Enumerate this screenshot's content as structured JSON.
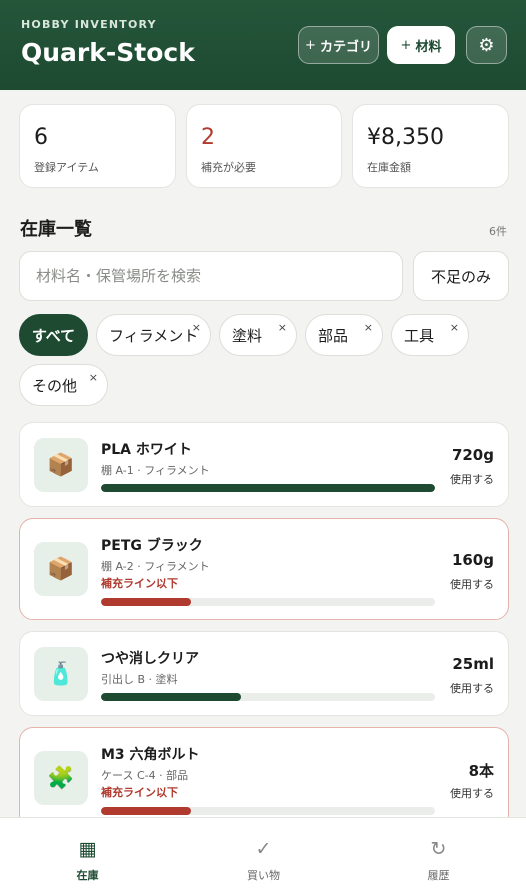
{
  "header": {
    "kicker": "HOBBY INVENTORY",
    "title": "Quark-Stock",
    "add_category_label": "カテゴリ",
    "add_material_label": "材料",
    "plus_glyph": "+",
    "settings_icon": "gear-icon"
  },
  "stats": [
    {
      "value": "6",
      "label": "登録アイテム"
    },
    {
      "value": "2",
      "label": "補充が必要"
    },
    {
      "value": "¥8,350",
      "label": "在庫金額"
    }
  ],
  "inventory": {
    "title": "在庫一覧",
    "count": "6件",
    "search_placeholder": "材料名・保管場所を検索",
    "search_value": "",
    "shortage_only_label": "不足のみ"
  },
  "chips": [
    {
      "label": "すべて",
      "active": true
    },
    {
      "label": "フィラメント",
      "active": false
    },
    {
      "label": "塗料",
      "active": false
    },
    {
      "label": "部品",
      "active": false
    },
    {
      "label": "工具",
      "active": false
    },
    {
      "label": "その他",
      "active": false
    }
  ],
  "chip_remove_glyph": "×",
  "items": [
    {
      "name": "PLA ホワイト",
      "meta": "棚 A-1 · フィラメント",
      "warning": "",
      "quantity": "720g",
      "action": "使用する",
      "level": 1.0,
      "icon": "box-icon",
      "low": false
    },
    {
      "name": "PETG ブラック",
      "meta": "棚 A-2 · フィラメント",
      "warning": "補充ライン以下",
      "quantity": "160g",
      "action": "使用する",
      "level": 0.27,
      "icon": "box-icon",
      "low": true
    },
    {
      "name": "つや消しクリア",
      "meta": "引出し B · 塗料",
      "warning": "",
      "quantity": "25ml",
      "action": "使用する",
      "level": 0.42,
      "icon": "spray-bottle-icon",
      "low": false
    },
    {
      "name": "M3 六角ボルト",
      "meta": "ケース C-4 · 部品",
      "warning": "補充ライン以下",
      "quantity": "8本",
      "action": "使用する",
      "level": 0.27,
      "icon": "puzzle-piece-icon",
      "low": true
    }
  ],
  "bottom_nav": [
    {
      "label": "在庫",
      "icon": "grid-icon",
      "active": true
    },
    {
      "label": "買い物",
      "icon": "checkmark-icon",
      "active": false
    },
    {
      "label": "履歴",
      "icon": "refresh-icon",
      "active": false
    }
  ],
  "colors": {
    "brand": "#1d4a31",
    "alert": "#b03a2e",
    "track": "#ebedea"
  }
}
